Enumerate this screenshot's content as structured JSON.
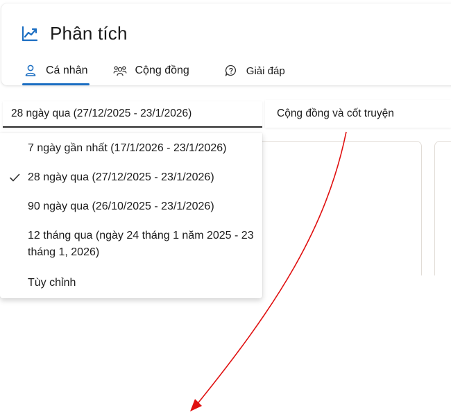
{
  "header": {
    "title": "Phân tích",
    "title_icon": "trending-chart-icon"
  },
  "tabs": [
    {
      "label": "Cá nhân",
      "icon": "person-icon",
      "active": true
    },
    {
      "label": "Cộng đồng",
      "icon": "people-community-icon",
      "active": false
    },
    {
      "label": "Giải đáp",
      "icon": "chat-question-icon",
      "active": false
    }
  ],
  "filters": {
    "date_range_selected": "28 ngày qua (27/12/2025 - 23/1/2026)",
    "topic_selected": "Cộng đồng và cốt truyện"
  },
  "date_menu": {
    "items": [
      {
        "label": "7 ngày gần nhất (17/1/2026 - 23/1/2026)",
        "checked": false
      },
      {
        "label": "28 ngày qua (27/12/2025 - 23/1/2026)",
        "checked": true
      },
      {
        "label": "90 ngày qua (26/10/2025 - 23/1/2026)",
        "checked": false
      },
      {
        "label": "12 tháng qua (ngày 24 tháng 1 năm 2025 - 23 tháng 1, 2026)",
        "checked": false
      },
      {
        "label": "Tùy chỉnh",
        "checked": false
      }
    ]
  },
  "colors": {
    "accent": "#1b6ec2",
    "annotation": "#e01010",
    "text": "#1b1b1b"
  }
}
